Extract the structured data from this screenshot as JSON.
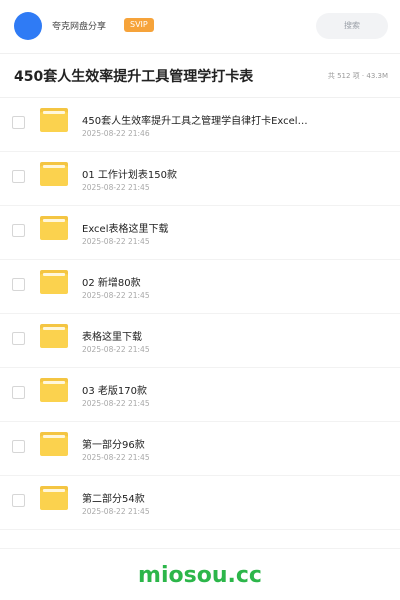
{
  "header": {
    "share_name": "夸克网盘分享",
    "badge": "SVIP",
    "search_placeholder": "搜索",
    "avatar_color": "#2f7bf5"
  },
  "title": {
    "text": "450套人生效率提升工具管理学打卡表",
    "meta": "共 512 项 · 43.3M"
  },
  "files": [
    {
      "name": "450套人生效率提升工具之管理学自律打卡Excel…",
      "date": "2025-08-22 21:46",
      "icon": "folder-icon"
    },
    {
      "name": "01 工作计划表150款",
      "date": "2025-08-22 21:45",
      "icon": "folder-icon"
    },
    {
      "name": "Excel表格这里下载",
      "date": "2025-08-22 21:45",
      "icon": "folder-icon"
    },
    {
      "name": "02 新增80款",
      "date": "2025-08-22 21:45",
      "icon": "folder-icon"
    },
    {
      "name": "表格这里下载",
      "date": "2025-08-22 21:45",
      "icon": "folder-icon"
    },
    {
      "name": "03 老版170款",
      "date": "2025-08-22 21:45",
      "icon": "folder-icon"
    },
    {
      "name": "第一部分96款",
      "date": "2025-08-22 21:45",
      "icon": "folder-icon"
    },
    {
      "name": "第二部分54款",
      "date": "2025-08-22 21:45",
      "icon": "folder-icon"
    }
  ],
  "footer": {
    "watermark": "miosou.cc",
    "watermark_color": "#2cb64a"
  },
  "colors": {
    "badge": "#f6a33a",
    "folder": "#fbd24e"
  }
}
